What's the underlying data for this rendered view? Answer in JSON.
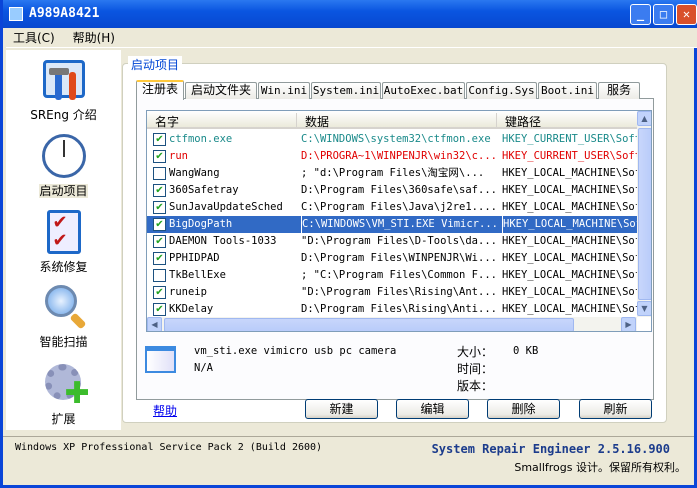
{
  "window": {
    "title": "A989A8421"
  },
  "menu": [
    "工具(C)",
    "帮助(H)"
  ],
  "sidebar": [
    {
      "label": "SREng 介绍",
      "icon": "tools-icon"
    },
    {
      "label": "启动项目",
      "icon": "clock-icon",
      "selected": true
    },
    {
      "label": "系统修复",
      "icon": "checklist-icon"
    },
    {
      "label": "智能扫描",
      "icon": "magnifier-icon"
    },
    {
      "label": "扩展",
      "icon": "gear-plus-icon"
    }
  ],
  "group_label": "启动项目",
  "tabs": [
    "注册表",
    "启动文件夹",
    "Win.ini",
    "System.ini",
    "AutoExec.bat",
    "Config.Sys",
    "Boot.ini",
    "服务"
  ],
  "columns": [
    "名字",
    "数据",
    "键路径"
  ],
  "rows": [
    {
      "checked": true,
      "name": "ctfmon.exe",
      "data": "C:\\WINDOWS\\system32\\ctfmon.exe",
      "path": "HKEY_CURRENT_USER\\Soft",
      "color": "#1a8a8a"
    },
    {
      "checked": true,
      "name": "run",
      "data": "D:\\PROGRA~1\\WINPENJR\\win32\\c...",
      "path": "HKEY_CURRENT_USER\\Soft",
      "color": "#e00000"
    },
    {
      "checked": false,
      "name": "WangWang",
      "data": "; \"d:\\Program Files\\淘宝网\\...",
      "path": "HKEY_LOCAL_MACHINE\\Sof"
    },
    {
      "checked": true,
      "name": "360Safetray",
      "data": "D:\\Program Files\\360safe\\saf...",
      "path": "HKEY_LOCAL_MACHINE\\Sof"
    },
    {
      "checked": true,
      "name": "SunJavaUpdateSched",
      "data": "C:\\Program Files\\Java\\j2re1....",
      "path": "HKEY_LOCAL_MACHINE\\Sof"
    },
    {
      "checked": true,
      "name": "BigDogPath",
      "data": "C:\\WINDOWS\\VM_STI.EXE Vimicr...",
      "path": "HKEY_LOCAL_MACHINE\\Sof",
      "selected": true
    },
    {
      "checked": true,
      "name": "DAEMON Tools-1033",
      "data": "\"D:\\Program Files\\D-Tools\\da...",
      "path": "HKEY_LOCAL_MACHINE\\Sof"
    },
    {
      "checked": true,
      "name": "PPHIDPAD",
      "data": "D:\\Program Files\\WINPENJR\\Wi...",
      "path": "HKEY_LOCAL_MACHINE\\Sof"
    },
    {
      "checked": false,
      "name": "TkBellExe",
      "data": "; \"C:\\Program Files\\Common F...",
      "path": "HKEY_LOCAL_MACHINE\\Sof"
    },
    {
      "checked": true,
      "name": "runeip",
      "data": "\"D:\\Program Files\\Rising\\Ant...",
      "path": "HKEY_LOCAL_MACHINE\\Sof"
    },
    {
      "checked": true,
      "name": "KKDelay",
      "data": "D:\\Program Files\\Rising\\Anti...",
      "path": "HKEY_LOCAL_MACHINE\\Sof"
    }
  ],
  "details": {
    "desc": "vm_sti.exe vimicro usb pc camera",
    "company": "N/A",
    "size_label": "大小：",
    "size": "0 KB",
    "time_label": "时间：",
    "version_label": "版本："
  },
  "help_link": "帮助",
  "buttons": [
    "新建",
    "编辑",
    "删除",
    "刷新"
  ],
  "status": {
    "os": "Windows XP Professional Service Pack 2 (Build 2600)",
    "product": "System Repair Engineer 2.5.16.900",
    "copyright": "Smallfrogs 设计。保留所有权利。"
  }
}
